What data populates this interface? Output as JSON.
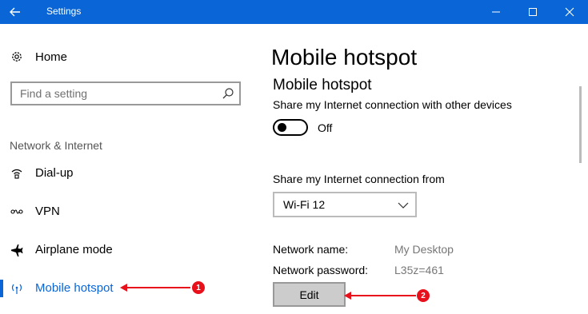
{
  "window": {
    "title": "Settings"
  },
  "sidebar": {
    "home_label": "Home",
    "search_placeholder": "Find a setting",
    "group_label": "Network & Internet",
    "items": [
      {
        "label": "Dial-up",
        "icon": "dialup-icon"
      },
      {
        "label": "VPN",
        "icon": "vpn-icon"
      },
      {
        "label": "Airplane mode",
        "icon": "airplane-icon"
      },
      {
        "label": "Mobile hotspot",
        "icon": "hotspot-icon",
        "active": true
      }
    ]
  },
  "main": {
    "page_title": "Mobile hotspot",
    "section_title": "Mobile hotspot",
    "share_label": "Share my Internet connection with other devices",
    "toggle_state": "Off",
    "from_label": "Share my Internet connection from",
    "connection_value": "Wi-Fi 12",
    "network_name_label": "Network name:",
    "network_name_value": "My Desktop",
    "network_password_label": "Network password:",
    "network_password_value": "L35z=461",
    "edit_label": "Edit"
  },
  "annotations": {
    "badge1": "1",
    "badge2": "2"
  },
  "colors": {
    "accent": "#0a66d6",
    "annotation": "#e8101b"
  }
}
